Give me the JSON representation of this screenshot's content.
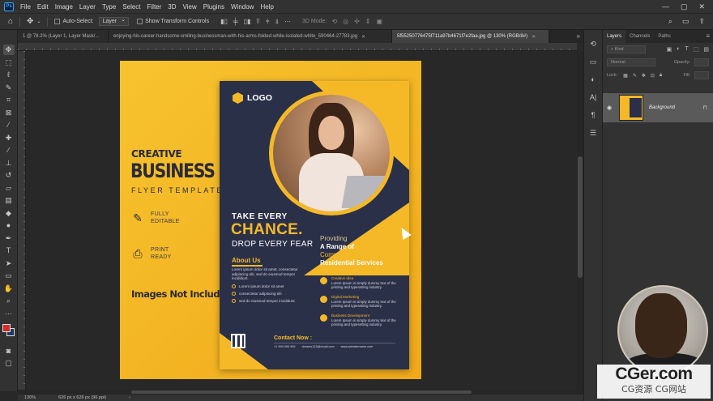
{
  "menubar": {
    "app_icon": "Ps",
    "items": [
      "File",
      "Edit",
      "Image",
      "Layer",
      "Type",
      "Select",
      "Filter",
      "3D",
      "View",
      "Plugins",
      "Window",
      "Help"
    ],
    "window_controls": [
      "—",
      "▢",
      "✕"
    ]
  },
  "options": {
    "auto_select_label": "Auto-Select:",
    "auto_select_value": "Layer",
    "transform_label": "Show Transform Controls",
    "mode_3d": "3D Mode:"
  },
  "tabs": [
    {
      "label": "1 @ 78.2% (Layer 1, Layer Mask/...",
      "active": false
    },
    {
      "label": "enjoying-his-career-handsome-smiling-businessman-with-his-arms-folded-while-isolated-white_590464-27783.jpg",
      "active": false
    },
    {
      "label": "5f55250776475f711a97b4671f7e2faa.jpg @ 130% (RGB/8#)",
      "active": true
    }
  ],
  "colors": {
    "foreground": "#d12d2d",
    "background": "#1e3a5f",
    "accent_yellow": "#f5b928",
    "navy": "#2b3049"
  },
  "flyer": {
    "creative": "CREATIVE",
    "business": "BUSINESS",
    "template": "FLYER TEMPLATE",
    "feature1": {
      "icon": "edit-icon",
      "line1": "FULLY",
      "line2": "EDITABLE"
    },
    "feature2": {
      "icon": "printer-icon",
      "line1": "PRINT",
      "line2": "READY"
    },
    "note": "Images Not Included"
  },
  "inner": {
    "logo": "LOGO",
    "take": "TAKE EVERY",
    "chance": "CHANCE.",
    "drop": "DROP EVERY FEAR",
    "about_title": "About Us",
    "about_text": "Lorem ipsum dolor sit amet, consectetur adipiscing elit, sed do eiusmod tempor incididunt.",
    "bullets": [
      "Lorem ipsum dolor sit amet",
      "consectetur adipiscing elit",
      "sed do eiusmod tempor incididunt"
    ],
    "providing": "Providing",
    "a_range": "A Range of",
    "commercial": "Commercial &",
    "residential": "Residential Services",
    "services": [
      {
        "title": "Creative Idea",
        "desc": "Lorem Ipsum is simply dummy text of the printing and typesetting industry."
      },
      {
        "title": "Digital Marketing",
        "desc": "Lorem Ipsum is simply dummy text of the printing and typesetting industry."
      },
      {
        "title": "Business Development",
        "desc": "Lorem Ipsum is simply dummy text of the printing and typesetting industry."
      }
    ],
    "contact_title": "Contact Now :",
    "phone": "+1 999 999 999",
    "email": "dreams123@email.com",
    "web": "www.websitename.com"
  },
  "layers_panel": {
    "tabs": [
      "Layers",
      "Channels",
      "Paths"
    ],
    "active_tab": "Layers",
    "kind_label": "Kind",
    "blend_mode": "Normal",
    "opacity_label": "Opacity:",
    "lock_label": "Lock:",
    "fill_label": "Fill:",
    "layer_name": "Background"
  },
  "status": {
    "zoom": "130%",
    "doc_size": "626 px x 626 px (96 ppi)"
  },
  "watermark": {
    "main": "CGer.com",
    "sub": "CG资源 CG网站"
  }
}
